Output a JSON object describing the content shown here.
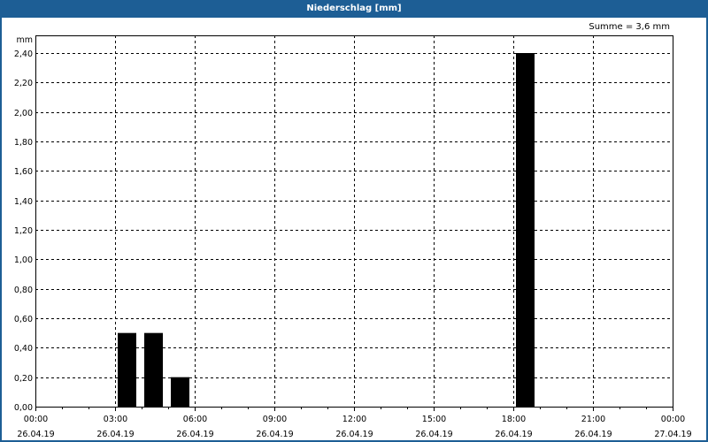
{
  "window": {
    "title": "Niederschlag [mm]"
  },
  "summary": "Summe = 3,6 mm",
  "chart_data": {
    "type": "bar",
    "title": "Niederschlag [mm]",
    "ylabel": "mm",
    "ylim": [
      0,
      2.52
    ],
    "yticks": [
      "0,00",
      "0,20",
      "0,40",
      "0,60",
      "0,80",
      "1,00",
      "1,20",
      "1,40",
      "1,60",
      "1,80",
      "2,00",
      "2,20",
      "2,40"
    ],
    "xlim_hours": [
      0,
      24
    ],
    "xticks": [
      {
        "time": "00:00",
        "date": "26.04.19"
      },
      {
        "time": "03:00",
        "date": "26.04.19"
      },
      {
        "time": "06:00",
        "date": "26.04.19"
      },
      {
        "time": "09:00",
        "date": "26.04.19"
      },
      {
        "time": "12:00",
        "date": "26.04.19"
      },
      {
        "time": "15:00",
        "date": "26.04.19"
      },
      {
        "time": "18:00",
        "date": "26.04.19"
      },
      {
        "time": "21:00",
        "date": "26.04.19"
      },
      {
        "time": "00:00",
        "date": "27.04.19"
      }
    ],
    "bars": [
      {
        "start_hour": 3,
        "end_hour": 4,
        "value": 0.5
      },
      {
        "start_hour": 4,
        "end_hour": 5,
        "value": 0.5
      },
      {
        "start_hour": 5,
        "end_hour": 6,
        "value": 0.2
      },
      {
        "start_hour": 18,
        "end_hour": 19,
        "value": 2.4
      }
    ],
    "grid": true,
    "bar_color": "#000000"
  }
}
